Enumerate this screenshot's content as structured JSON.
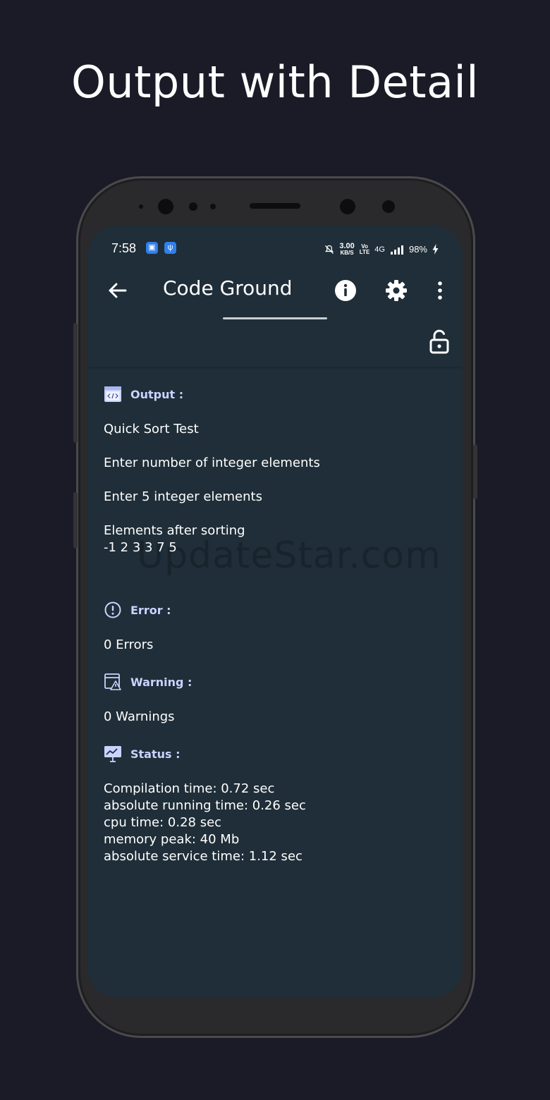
{
  "promo": {
    "title": "Output with Detail"
  },
  "status_bar": {
    "time": "7:58",
    "net_speed_value": "3.00",
    "net_speed_unit": "KB/S",
    "volte_top": "Vo",
    "volte_bottom": "LTE",
    "network": "4G",
    "battery": "98%"
  },
  "app_bar": {
    "title": "Code Ground"
  },
  "output": {
    "label": "Output :",
    "lines": [
      "Quick Sort Test",
      "Enter number of integer elements",
      "Enter 5 integer elements",
      "Elements after sorting",
      "-1 2 3 3 7 5"
    ]
  },
  "error": {
    "label": "Error :",
    "text": "0 Errors"
  },
  "warning": {
    "label": "Warning :",
    "text": "0 Warnings"
  },
  "status": {
    "label": "Status :",
    "lines": [
      "Compilation time: 0.72 sec",
      "absolute running time: 0.26 sec",
      "cpu time: 0.28 sec",
      "memory peak: 40 Mb",
      "absolute service time: 1.12 sec"
    ]
  },
  "watermark": "UpdateStar.com"
}
